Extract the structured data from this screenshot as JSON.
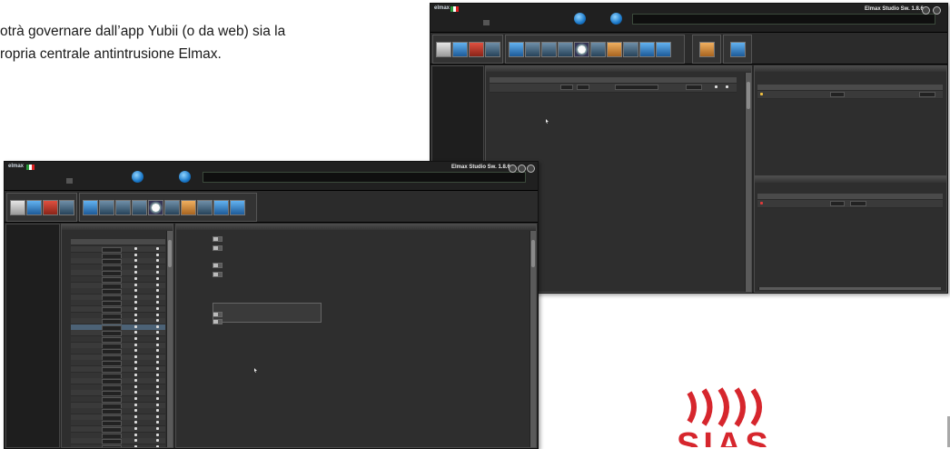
{
  "intro": {
    "line1": "otrà governare dall’app Yubii (o da web) sia la",
    "line2": "ropria centrale antintrusione Elmax."
  },
  "windows": {
    "back": {
      "app_title": "Elmax Studio Sw. 1.8.6",
      "brand": "elmax"
    },
    "front": {
      "app_title": "Elmax Studio Sw. 1.8.6",
      "brand": "elmax"
    }
  },
  "icons": {
    "globe": "globe-icon",
    "window_controls": [
      "minimize-icon",
      "maximize-icon",
      "close-icon"
    ],
    "cursor": "mouse-pointer-icon"
  },
  "colors": {
    "window_bg": "#262626",
    "toolbar_blue": "#1d5a98",
    "status_green": "#a6c36a",
    "logo_red": "#d6262d"
  },
  "logo": {
    "brand": "SIAS",
    "color": "#d6262d"
  }
}
